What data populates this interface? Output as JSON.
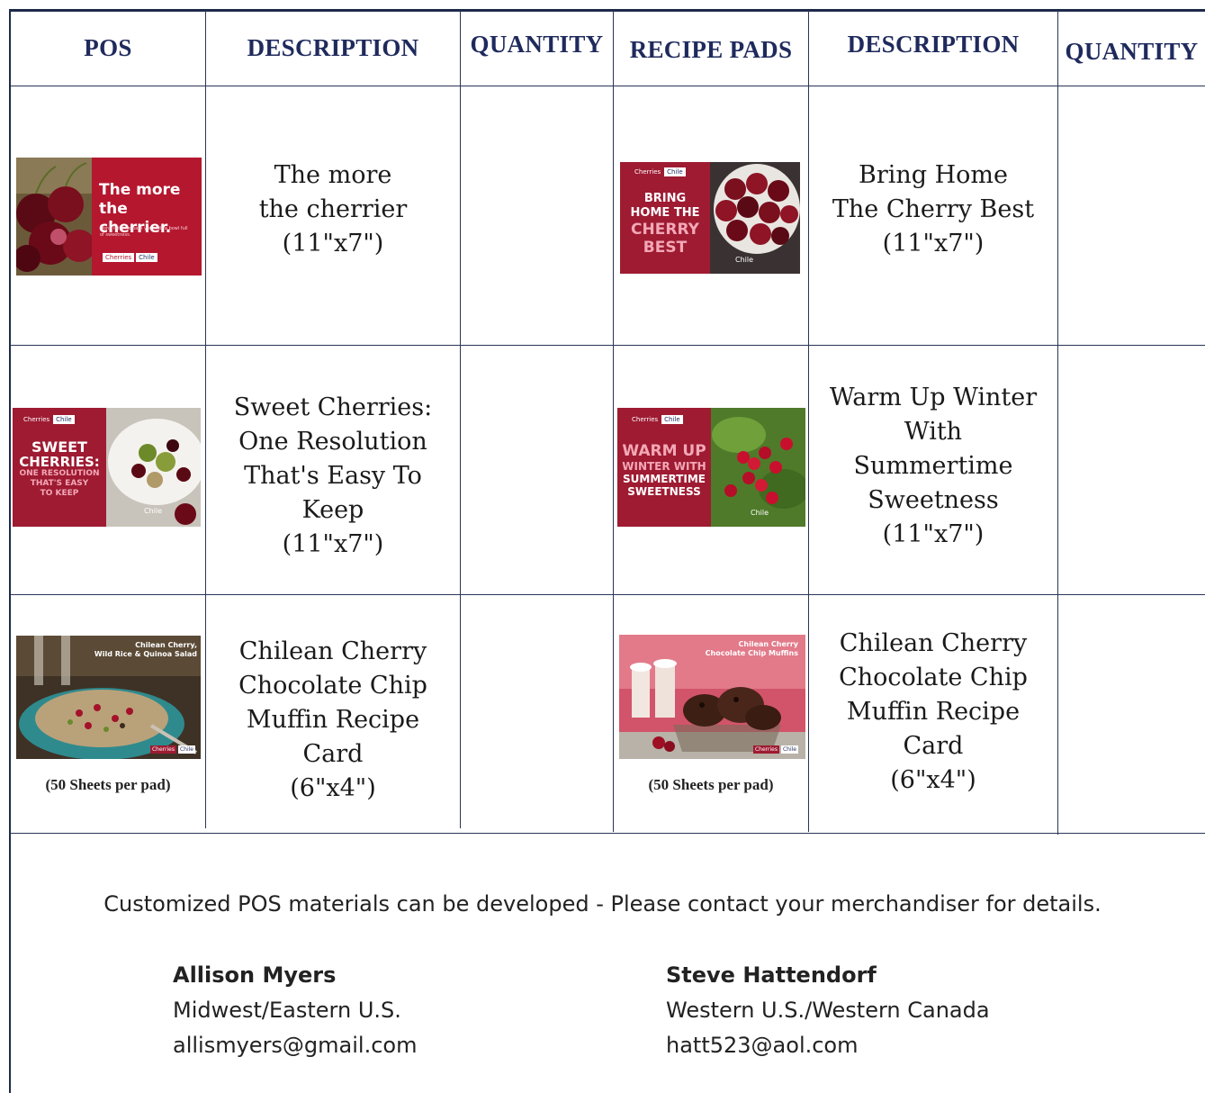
{
  "headers": {
    "pos": "POS",
    "description_left": "DESCRIPTION",
    "quantity_left": "QUANTITY",
    "recipe_pads": "RECIPE PADS",
    "description_right": "DESCRIPTION",
    "quantity_right": "QUANTITY"
  },
  "rows": [
    {
      "pos_image": {
        "lines": [
          "The more",
          "the cherrier."
        ],
        "small": "Don't let time pass you with a bowl full of sweetness.",
        "brand_left": "Cherries",
        "brand_right": "Chile"
      },
      "pos_desc": [
        "The more",
        "the cherrier",
        "(11\"x7\")"
      ],
      "pad_image": {
        "brand_left": "Cherries",
        "brand_right": "Chile",
        "lines": [
          "BRING",
          "HOME THE",
          "CHERRY",
          "BEST"
        ],
        "footer": "Chile"
      },
      "pad_desc": [
        "Bring Home",
        "The Cherry Best",
        "(11\"x7\")"
      ]
    },
    {
      "pos_image": {
        "brand_left": "Cherries",
        "brand_right": "Chile",
        "lines": [
          "SWEET",
          "CHERRIES:",
          "ONE RESOLUTION",
          "THAT'S EASY",
          "TO KEEP"
        ],
        "footer": "Chile"
      },
      "pos_desc": [
        "Sweet Cherries:",
        "One Resolution",
        "That's Easy To",
        "Keep",
        "(11\"x7\")"
      ],
      "pad_image": {
        "brand_left": "Cherries",
        "brand_right": "Chile",
        "lines": [
          "WARM UP",
          "WINTER WITH",
          "SUMMERTIME",
          "SWEETNESS"
        ],
        "footer": "Chile"
      },
      "pad_desc": [
        "Warm Up Winter",
        "With",
        "Summertime",
        "Sweetness",
        "(11\"x7\")"
      ]
    },
    {
      "pos_image": {
        "lines": [
          "Chilean Cherry,",
          "Wild Rice & Quinoa Salad"
        ],
        "brand_left": "Cherries",
        "brand_right": "Chile"
      },
      "pos_note": "(50 Sheets per pad)",
      "pos_desc": [
        "Chilean Cherry",
        "Chocolate Chip",
        "Muffin  Recipe",
        "Card",
        "(6\"x4\")"
      ],
      "pad_image": {
        "lines": [
          "Chilean Cherry",
          "Chocolate Chip Muffins"
        ],
        "brand_left": "Cherries",
        "brand_right": "Chile"
      },
      "pad_note": "(50 Sheets per pad)",
      "pad_desc": [
        "Chilean Cherry",
        "Chocolate Chip",
        "Muffin  Recipe",
        "Card",
        "(6\"x4\")"
      ]
    }
  ],
  "footer": {
    "note": "Customized POS materials can be developed - Please contact your merchandiser for details.",
    "contacts": [
      {
        "name": "Allison Myers",
        "region": "Midwest/Eastern U.S.",
        "email": "allismyers@gmail.com"
      },
      {
        "name": "Steve Hattendorf",
        "region": "Western U.S./Western Canada",
        "email": "hatt523@aol.com"
      }
    ]
  },
  "colors": {
    "header_text": "#1f2a5c",
    "rule": "#2a3556",
    "brand_red": "#9e1b32",
    "cherry_dark": "#5a0a14"
  }
}
